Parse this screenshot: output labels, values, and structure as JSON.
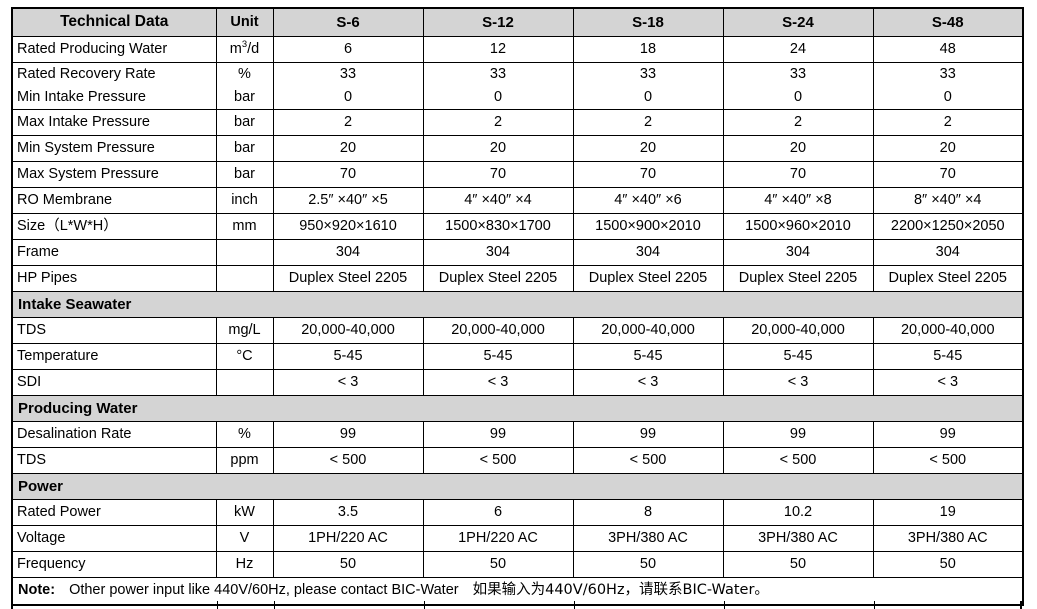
{
  "table": {
    "header": {
      "name_label": "Technical Data",
      "unit_label": "Unit",
      "models": [
        "S-6",
        "S-12",
        "S-18",
        "S-24",
        "S-48"
      ]
    },
    "rows": [
      {
        "name": "Rated Producing Water",
        "unit_html": "m<sup>3</sup>/d",
        "unit": "m3/d",
        "values": [
          "6",
          "12",
          "18",
          "24",
          "48"
        ]
      },
      {
        "name": "Rated Recovery Rate",
        "unit": "%",
        "values": [
          "33",
          "33",
          "33",
          "33",
          "33"
        ]
      },
      {
        "name": "Min Intake Pressure",
        "unit": "bar",
        "values": [
          "0",
          "0",
          "0",
          "0",
          "0"
        ]
      },
      {
        "name": "Max Intake Pressure",
        "unit": "bar",
        "values": [
          "2",
          "2",
          "2",
          "2",
          "2"
        ]
      },
      {
        "name": "Min System Pressure",
        "unit": "bar",
        "values": [
          "20",
          "20",
          "20",
          "20",
          "20"
        ]
      },
      {
        "name": "Max System Pressure",
        "unit": "bar",
        "values": [
          "70",
          "70",
          "70",
          "70",
          "70"
        ]
      },
      {
        "name": "RO Membrane",
        "unit": "inch",
        "values": [
          "2.5″ ×40″ ×5",
          "4″ ×40″ ×4",
          "4″ ×40″ ×6",
          "4″ ×40″ ×8",
          "8″ ×40″ ×4"
        ]
      },
      {
        "name": "Size（L*W*H）",
        "unit": "mm",
        "values": [
          "950×920×1610",
          "1500×830×1700",
          "1500×900×2010",
          "1500×960×2010",
          "2200×1250×2050"
        ]
      },
      {
        "name": "Frame",
        "unit": "",
        "values": [
          "304",
          "304",
          "304",
          "304",
          "304"
        ]
      },
      {
        "name": "HP Pipes",
        "unit": "",
        "values": [
          "Duplex Steel 2205",
          "Duplex Steel 2205",
          "Duplex Steel 2205",
          "Duplex Steel 2205",
          "Duplex Steel 2205"
        ]
      }
    ],
    "section_intake": "Intake Seawater",
    "rows_intake": [
      {
        "name": "TDS",
        "unit": "mg/L",
        "values": [
          "20,000-40,000",
          "20,000-40,000",
          "20,000-40,000",
          "20,000-40,000",
          "20,000-40,000"
        ]
      },
      {
        "name": "Temperature",
        "unit": "°C",
        "values": [
          "5-45",
          "5-45",
          "5-45",
          "5-45",
          "5-45"
        ]
      },
      {
        "name": "SDI",
        "unit": "",
        "values": [
          "< 3",
          "< 3",
          "< 3",
          "< 3",
          "< 3"
        ]
      }
    ],
    "section_producing": "Producing Water",
    "rows_producing": [
      {
        "name": "Desalination Rate",
        "unit": "%",
        "values": [
          "99",
          "99",
          "99",
          "99",
          "99"
        ]
      },
      {
        "name": "TDS",
        "unit": "ppm",
        "values": [
          "< 500",
          "< 500",
          "< 500",
          "< 500",
          "< 500"
        ]
      }
    ],
    "section_power": "Power",
    "rows_power": [
      {
        "name": "Rated Power",
        "unit": "kW",
        "values": [
          "3.5",
          "6",
          "8",
          "10.2",
          "19"
        ]
      },
      {
        "name": "Voltage",
        "unit": "V",
        "values": [
          "1PH/220 AC",
          "1PH/220 AC",
          "3PH/380 AC",
          "3PH/380 AC",
          "3PH/380 AC"
        ]
      },
      {
        "name": "Frequency",
        "unit": "Hz",
        "values": [
          "50",
          "50",
          "50",
          "50",
          "50"
        ]
      }
    ],
    "note": {
      "label": "Note:",
      "text_en": "Other power input like 440V/60Hz, please contact BIC-Water",
      "text_cn": "如果输入为440V/60Hz，请联系BIC-Water。"
    }
  },
  "colors": {
    "header_fill": "#d4d4d4",
    "section_fill": "#d4d4d4",
    "border": "#000000",
    "text": "#000000",
    "page_background": "#ffffff"
  }
}
